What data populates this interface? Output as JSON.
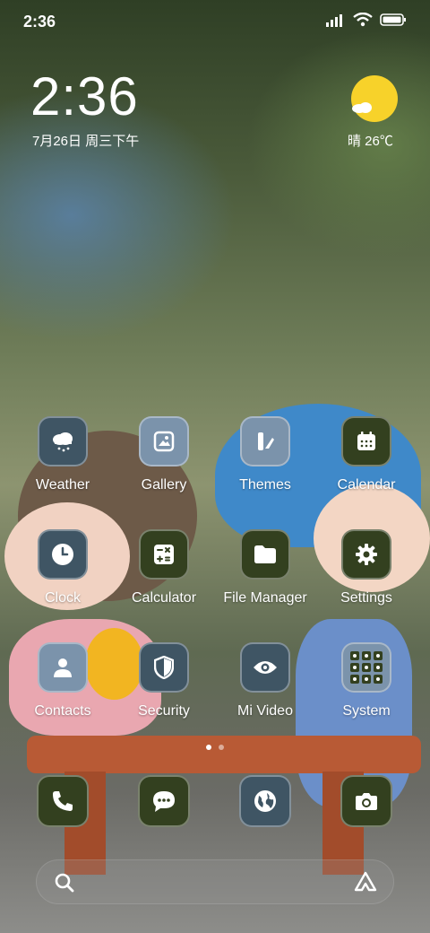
{
  "status_bar": {
    "time": "2:36"
  },
  "clock_widget": {
    "time": "2:36",
    "date": "7月26日 周三下午"
  },
  "weather_widget": {
    "text": "晴 26℃"
  },
  "apps_row1": [
    {
      "label": "Weather",
      "icon": "weather-icon",
      "color": "#3f5564"
    },
    {
      "label": "Gallery",
      "icon": "gallery-icon",
      "color": "#7b93ab"
    },
    {
      "label": "Themes",
      "icon": "themes-icon",
      "color": "#7b93ab"
    },
    {
      "label": "Calendar",
      "icon": "calendar-icon",
      "color": "#33401f"
    }
  ],
  "apps_row2": [
    {
      "label": "Clock",
      "icon": "clock-icon",
      "color": "#3f5564"
    },
    {
      "label": "Calculator",
      "icon": "calculator-icon",
      "color": "#33401f"
    },
    {
      "label": "File Manager",
      "icon": "folder-icon",
      "color": "#33401f"
    },
    {
      "label": "Settings",
      "icon": "gear-icon",
      "color": "#33401f"
    }
  ],
  "apps_row3": [
    {
      "label": "Contacts",
      "icon": "contacts-icon",
      "color": "#7b93ab"
    },
    {
      "label": "Security",
      "icon": "shield-icon",
      "color": "#3f5564"
    },
    {
      "label": "Mi Video",
      "icon": "eye-icon",
      "color": "#3f5564"
    },
    {
      "label": "System",
      "icon": "folder-grid-icon",
      "color": "#7b93ab"
    }
  ],
  "dock": [
    {
      "icon": "phone-icon",
      "color": "#33401f"
    },
    {
      "icon": "message-icon",
      "color": "#33401f"
    },
    {
      "icon": "browser-icon",
      "color": "#3f5564"
    },
    {
      "icon": "camera-icon",
      "color": "#33401f"
    }
  ],
  "page_indicator": {
    "pages": 2,
    "current": 1
  }
}
